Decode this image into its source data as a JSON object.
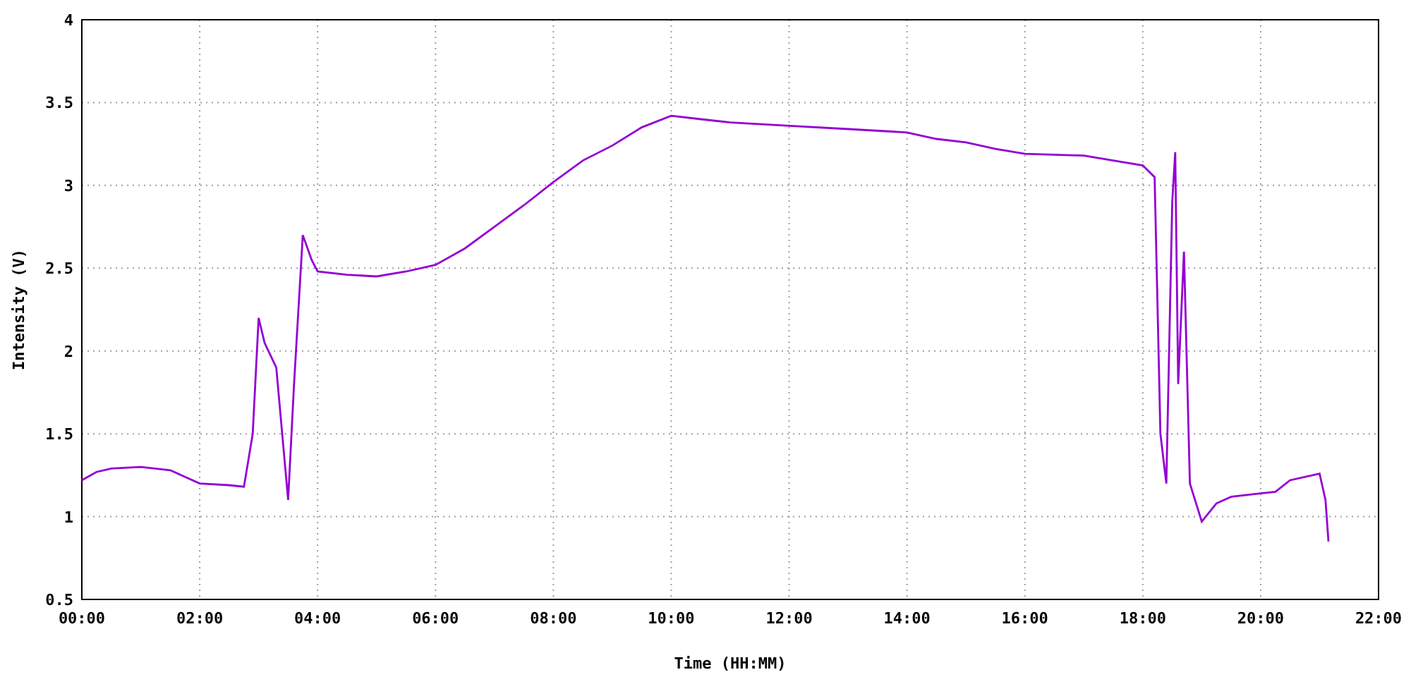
{
  "chart_data": {
    "type": "line",
    "grid": true,
    "xlabel": "Time (HH:MM)",
    "ylabel": "Intensity (V)",
    "xlim": [
      0,
      22
    ],
    "ylim": [
      0.5,
      4
    ],
    "xticks": [
      {
        "value": 0,
        "label": "00:00"
      },
      {
        "value": 2,
        "label": "02:00"
      },
      {
        "value": 4,
        "label": "04:00"
      },
      {
        "value": 6,
        "label": "06:00"
      },
      {
        "value": 8,
        "label": "08:00"
      },
      {
        "value": 10,
        "label": "10:00"
      },
      {
        "value": 12,
        "label": "12:00"
      },
      {
        "value": 14,
        "label": "14:00"
      },
      {
        "value": 16,
        "label": "16:00"
      },
      {
        "value": 18,
        "label": "18:00"
      },
      {
        "value": 20,
        "label": "20:00"
      },
      {
        "value": 22,
        "label": "22:00"
      }
    ],
    "yticks": [
      {
        "value": 0.5,
        "label": "0.5"
      },
      {
        "value": 1,
        "label": "1"
      },
      {
        "value": 1.5,
        "label": "1.5"
      },
      {
        "value": 2,
        "label": "2"
      },
      {
        "value": 2.5,
        "label": "2.5"
      },
      {
        "value": 3,
        "label": "3"
      },
      {
        "value": 3.5,
        "label": "3.5"
      },
      {
        "value": 4,
        "label": "4"
      }
    ],
    "x": [
      0,
      0.25,
      0.5,
      1,
      1.5,
      2,
      2.5,
      2.75,
      2.9,
      3.0,
      3.1,
      3.3,
      3.5,
      3.6,
      3.75,
      3.9,
      4,
      4.5,
      5,
      5.5,
      6,
      6.5,
      7,
      7.5,
      8,
      8.5,
      9,
      9.5,
      10,
      10.5,
      11,
      12,
      13,
      14,
      14.5,
      15,
      15.5,
      16,
      17,
      17.5,
      18,
      18.2,
      18.3,
      18.4,
      18.5,
      18.55,
      18.6,
      18.7,
      18.8,
      19,
      19.25,
      19.5,
      20,
      20.25,
      20.5,
      21,
      21.1,
      21.15
    ],
    "series": [
      {
        "color": "#9400d3",
        "values": [
          1.22,
          1.27,
          1.29,
          1.3,
          1.28,
          1.2,
          1.19,
          1.18,
          1.5,
          2.2,
          2.05,
          1.9,
          1.1,
          1.8,
          2.7,
          2.55,
          2.48,
          2.46,
          2.45,
          2.48,
          2.52,
          2.62,
          2.75,
          2.88,
          3.02,
          3.15,
          3.24,
          3.35,
          3.42,
          3.4,
          3.38,
          3.36,
          3.34,
          3.32,
          3.28,
          3.26,
          3.22,
          3.19,
          3.18,
          3.15,
          3.12,
          3.05,
          1.5,
          1.2,
          2.9,
          3.2,
          1.8,
          2.6,
          1.2,
          0.97,
          1.08,
          1.12,
          1.14,
          1.15,
          1.22,
          1.26,
          1.1,
          0.85
        ]
      }
    ]
  }
}
